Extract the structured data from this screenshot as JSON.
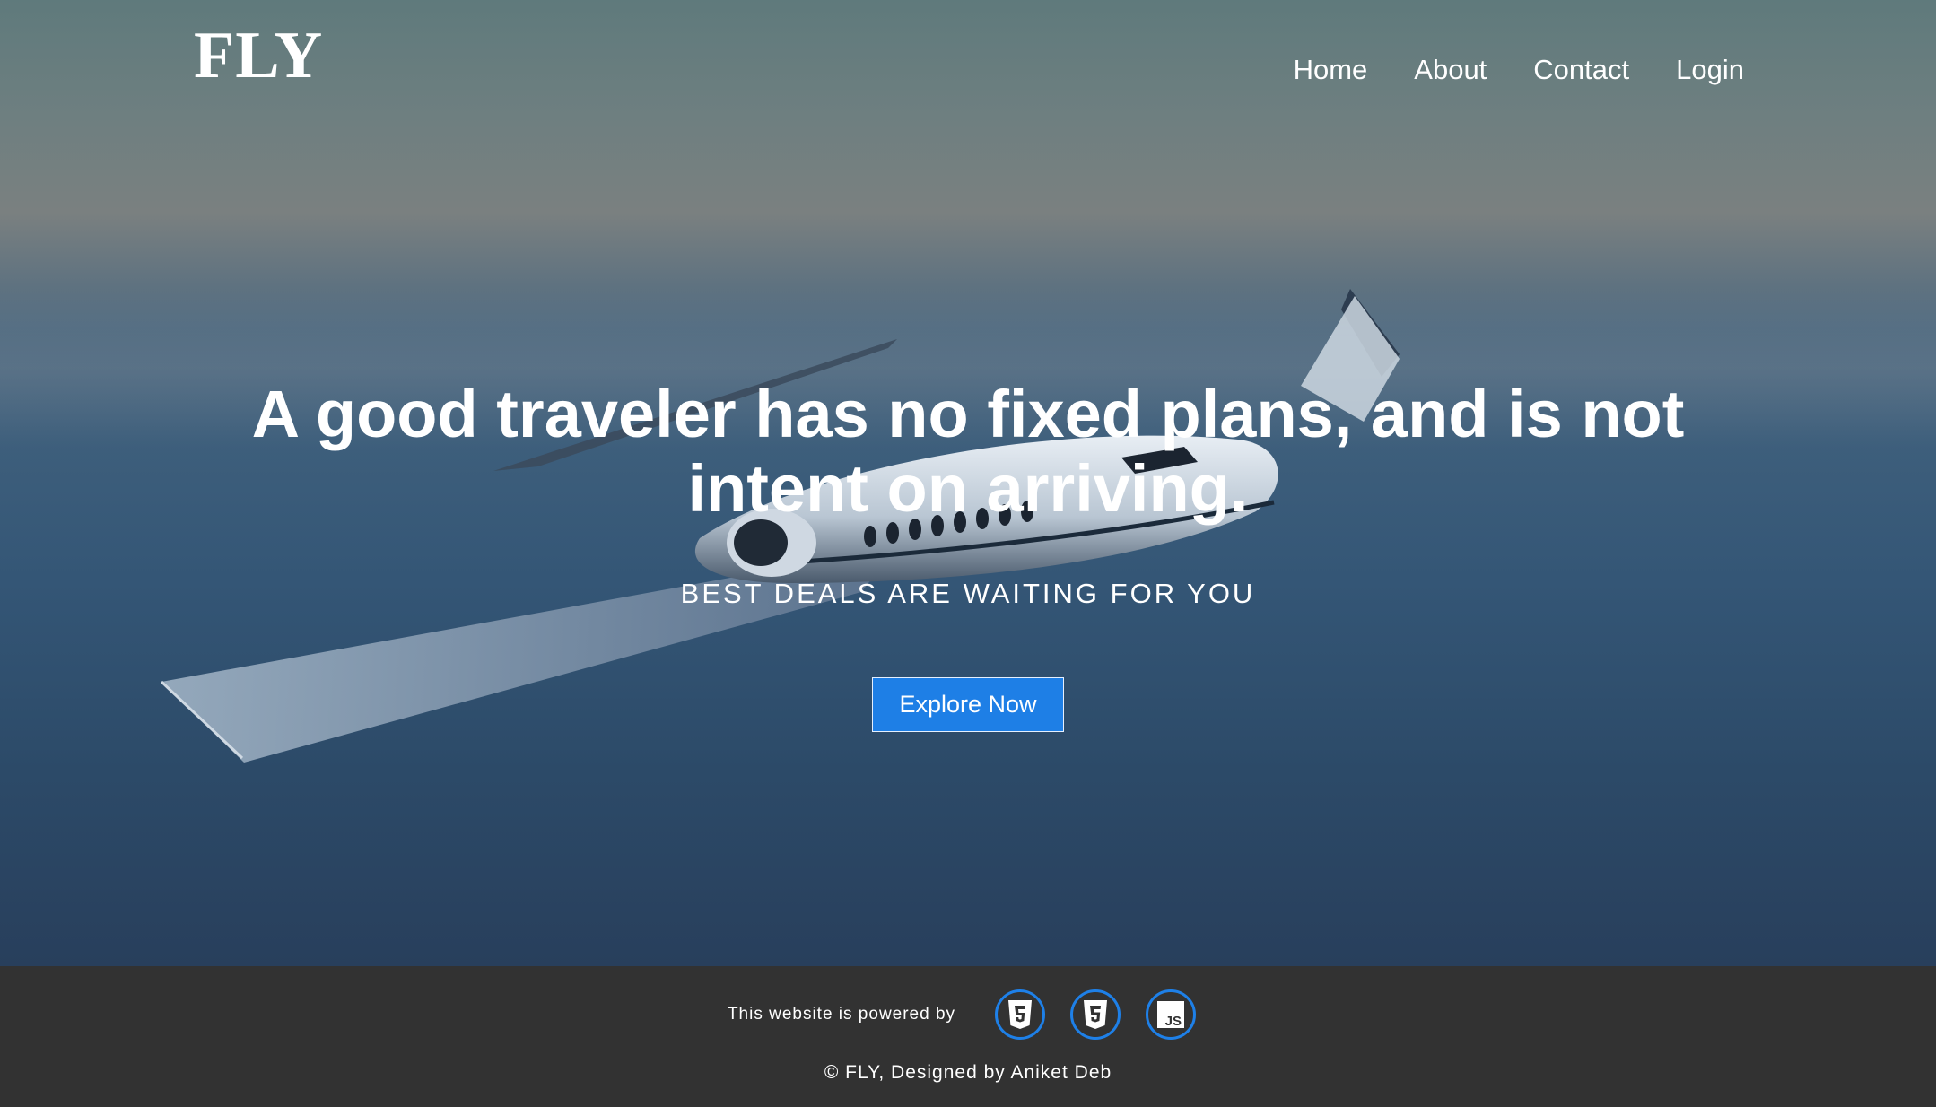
{
  "brand": {
    "logo": "FLY"
  },
  "nav": {
    "items": [
      {
        "label": "Home"
      },
      {
        "label": "About"
      },
      {
        "label": "Contact"
      },
      {
        "label": "Login"
      }
    ]
  },
  "hero": {
    "headline_line1": "A good traveler has no fixed plans, and is not",
    "headline_line2": "intent on arriving.",
    "subtitle": "BEST DEALS ARE WAITING FOR YOU",
    "cta_label": "Explore Now",
    "background_image": "private-jet-over-ocean"
  },
  "footer": {
    "powered_text": "This website is powered by",
    "tech_icons": [
      {
        "name": "html5-icon"
      },
      {
        "name": "css3-icon"
      },
      {
        "name": "js-icon"
      }
    ],
    "copyright": "© FLY, Designed by Aniket Deb"
  },
  "colors": {
    "accent": "#1e7fe6",
    "footer_bg": "#323232",
    "text": "#ffffff"
  }
}
